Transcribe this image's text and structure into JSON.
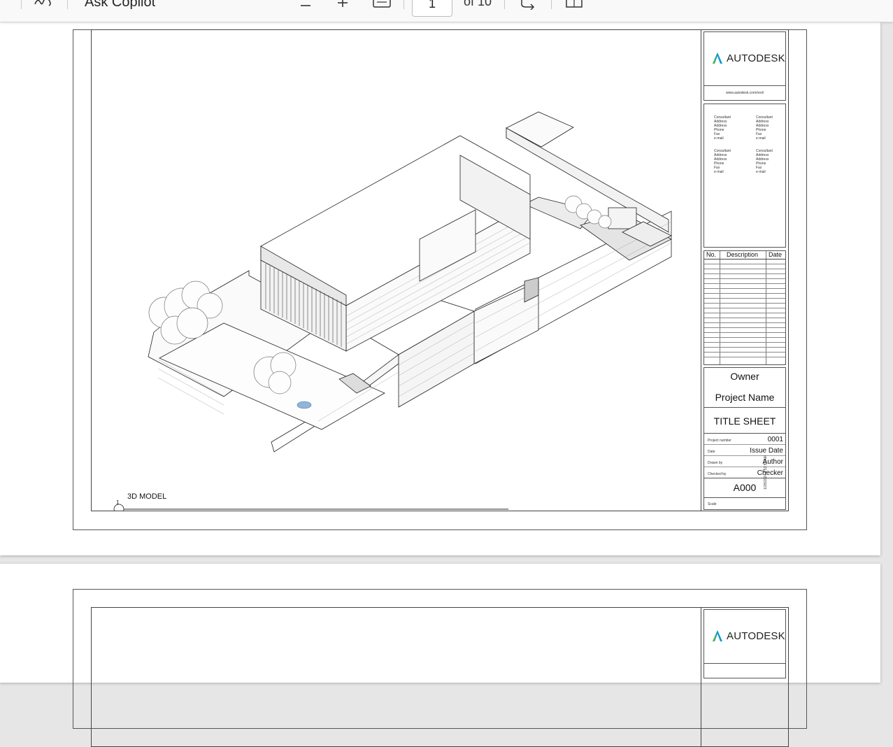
{
  "toolbar": {
    "ask_copilot_label": "Ask Copilot",
    "current_page": "1",
    "page_count_label": "of 10",
    "icons": [
      "text-aA-icon",
      "zoom-out-icon",
      "zoom-in-icon",
      "fit-page-icon",
      "rotate-icon",
      "page-view-icon"
    ]
  },
  "sheet": {
    "brand": "AUTODESK",
    "brand_url": "www.autodesk.com/revit",
    "consultants": [
      [
        "Consultant",
        "Address",
        "Address",
        "Phone",
        "Fax",
        "e-mail"
      ],
      [
        "Consultant",
        "Address",
        "Address",
        "Phone",
        "Fax",
        "e-mail"
      ],
      [
        "Consultant",
        "Address",
        "Address",
        "Phone",
        "Fax",
        "e-mail"
      ],
      [
        "Consultant",
        "Address",
        "Address",
        "Phone",
        "Fax",
        "e-mail"
      ]
    ],
    "revision_headers": {
      "no": "No.",
      "description": "Description",
      "date": "Date"
    },
    "owner": "Owner",
    "project_name": "Project Name",
    "sheet_title": "TITLE SHEET",
    "fields": {
      "project_number_label": "Project number",
      "project_number": "0001",
      "date_label": "Date",
      "date": "Issue Date",
      "drawn_by_label": "Drawn by",
      "drawn_by": "Author",
      "checked_by_label": "Checked by",
      "checked_by": "Checker",
      "sheet_number": "A000",
      "scale_label": "Scale"
    },
    "timestamp": "1/28/2024 1:53:55 AM",
    "view_number": "1",
    "view_title": "3D MODEL"
  },
  "page2": {
    "brand": "AUTODESK"
  }
}
